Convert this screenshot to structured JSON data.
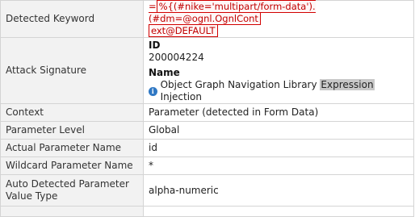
{
  "rows": {
    "keyword": {
      "label": "Detected Keyword",
      "prefix": "=",
      "value_line1": "%{(#nike='multipart/form-data').(#dm=@ognl.OgnlCont",
      "value_line2": "ext@DEFAULT"
    },
    "signature": {
      "label": "Attack Signature",
      "id_label": "ID",
      "id_value": "200004224",
      "name_label": "Name",
      "name_part1": "Object Graph Navigation Library ",
      "name_highlight": "Expression",
      "name_part2": " Injection",
      "info_icon": "info-icon"
    },
    "context": {
      "label": "Context",
      "value": "Parameter (detected in Form Data)"
    },
    "parameter_level": {
      "label": "Parameter Level",
      "value": "Global"
    },
    "actual_parameter_name": {
      "label": "Actual Parameter Name",
      "value": "id"
    },
    "wildcard_parameter_name": {
      "label": "Wildcard Parameter Name",
      "value": "*"
    },
    "auto_detected_value_type": {
      "label": "Auto Detected Parameter Value Type",
      "value": "alpha-numeric"
    }
  },
  "colors": {
    "label_bg": "#f2f2f2",
    "border": "#d4d4d4",
    "keyword_red": "#c00000",
    "info_blue": "#2f78c4",
    "highlight_gray": "#c8c8c8"
  }
}
